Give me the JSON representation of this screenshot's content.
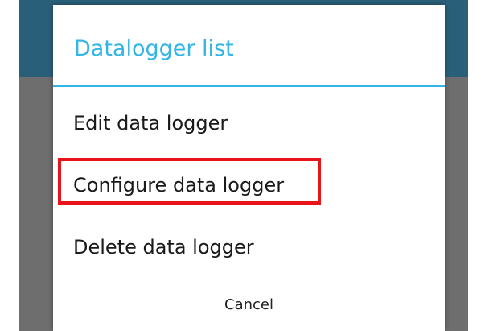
{
  "dialog": {
    "title": "Datalogger list",
    "items": [
      {
        "label": "Edit data logger"
      },
      {
        "label": "Configure data logger",
        "highlighted": true
      },
      {
        "label": "Delete data logger"
      }
    ],
    "cancel_label": "Cancel"
  },
  "colors": {
    "title": "#33b5e5",
    "divider": "#33b5e5",
    "highlight_border": "#e8141a",
    "scrim": "#6e6e6e",
    "app_bar": "#2a5f7a"
  }
}
